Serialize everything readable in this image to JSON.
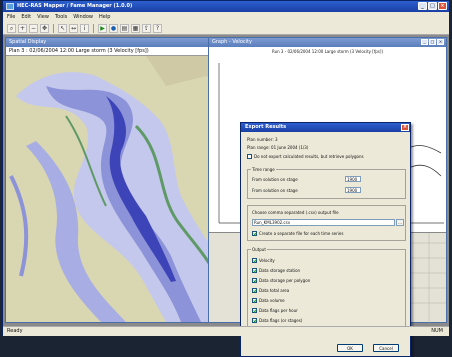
{
  "app": {
    "title": "HEC-RAS Mapper / Fame Manager (1.0.0)"
  },
  "menu": [
    "File",
    "Edit",
    "View",
    "Tools",
    "Window",
    "Help"
  ],
  "toolbar": {
    "icons": [
      "search-icon",
      "zoom-in-icon",
      "zoom-out-icon",
      "pan-icon",
      "select-icon",
      "measure-icon",
      "identify-icon",
      "run-icon",
      "globe-icon",
      "plot-icon",
      "table-icon",
      "export-icon",
      "help-icon"
    ]
  },
  "map_window": {
    "title": "Spatial Display",
    "caption": "Plan 3 : 02/06/2004 12:00 Large storm (3 Velocity [fps])",
    "colors": {
      "ground": "#d9d6b2",
      "water_light": "#c4c8ec",
      "water_mid": "#8c93d8",
      "water_deep": "#3d44b8",
      "levee": "#5f9a66"
    }
  },
  "plot_window": {
    "title": "Graph - Velocity",
    "caption": "Run 3 - 02/06/2004 12:00 Large storm (3 Velocity [fps])"
  },
  "dialog": {
    "title": "Export Results",
    "line1": "Plan number: 3",
    "line2": "Plan range: 01 June 2004 (1/3)",
    "option_label": "Do not export calculated results, but retrieve polygons",
    "range_group": "Time range",
    "from_label": "From solution on stage",
    "from_value": "1900",
    "to_label": "From solution on stage",
    "to_value": "1900",
    "file_label": "Choose comma separated (.csv) output file",
    "file_value": "Run_KML3902.csv",
    "browse_label": "...",
    "separate_label": "Create a separate file for each time series",
    "output_group": "Output",
    "outputs": [
      {
        "label": "Velocity",
        "checked": true
      },
      {
        "label": "Data storage station",
        "checked": true
      },
      {
        "label": "Data storage per polygon",
        "checked": true
      },
      {
        "label": "Data total area",
        "checked": true
      },
      {
        "label": "Data volume",
        "checked": true
      },
      {
        "label": "Data flags per hour",
        "checked": true
      },
      {
        "label": "Data flags (or stages)",
        "checked": true
      }
    ],
    "ok_label": "OK",
    "cancel_label": "Cancel"
  },
  "status": {
    "left": "Ready",
    "right": "NUM"
  }
}
